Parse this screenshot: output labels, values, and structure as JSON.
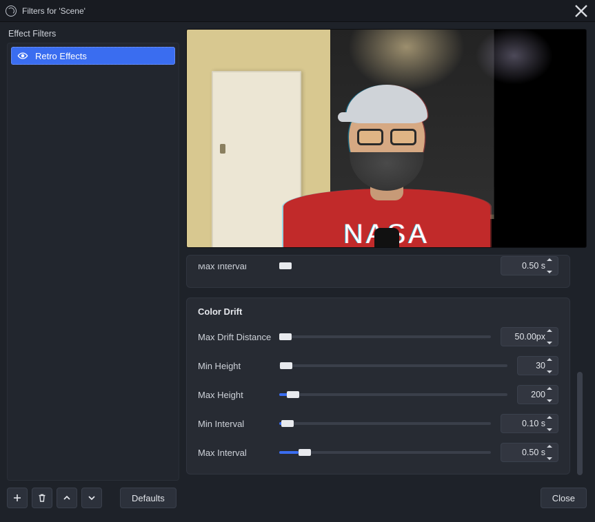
{
  "titlebar": {
    "title": "Filters for 'Scene'"
  },
  "sidebar": {
    "section_label": "Effect Filters",
    "filters": [
      {
        "label": "Retro Effects",
        "visible": true
      }
    ]
  },
  "preview": {
    "shirt_text": "NASA"
  },
  "settings": {
    "cutoff_prev": {
      "label": "Max Interval",
      "value": "0.50 s"
    },
    "group_title": "Color Drift",
    "fields": [
      {
        "key": "max_drift_dist",
        "label": "Max Drift Distance",
        "value": "50.00px",
        "fill_pct": 3,
        "thumb_pct": 3,
        "spin_narrow": false
      },
      {
        "key": "min_height",
        "label": "Min Height",
        "value": "30",
        "fill_pct": 0,
        "thumb_pct": 3,
        "spin_narrow": true
      },
      {
        "key": "max_height",
        "label": "Max Height",
        "value": "200",
        "fill_pct": 4,
        "thumb_pct": 6,
        "spin_narrow": true
      },
      {
        "key": "min_interval",
        "label": "Min Interval",
        "value": "0.10 s",
        "fill_pct": 2,
        "thumb_pct": 4,
        "spin_narrow": false
      },
      {
        "key": "max_interval",
        "label": "Max Interval",
        "value": "0.50 s",
        "fill_pct": 9,
        "thumb_pct": 12,
        "spin_narrow": false
      }
    ]
  },
  "footer": {
    "defaults_label": "Defaults",
    "close_label": "Close"
  }
}
